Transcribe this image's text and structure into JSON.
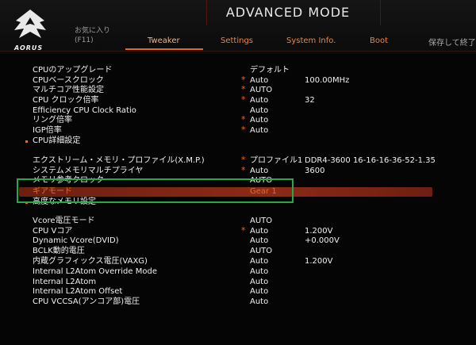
{
  "header": {
    "logo_text": "AORUS",
    "mode_title": "ADVANCED MODE",
    "back_label_line1": "お気に入り",
    "back_label_line2": "(F11)",
    "tabs": [
      "Tweaker",
      "Settings",
      "System Info.",
      "Boot"
    ],
    "active_tab": "Tweaker",
    "save_exit_label": "保存して終了"
  },
  "rows": [
    {
      "label": "CPUのアップグレード",
      "value": "デフォルト",
      "star": "",
      "extra": ""
    },
    {
      "label": "CPUベースクロック",
      "value": "Auto",
      "star": "*",
      "extra": "100.00MHz"
    },
    {
      "label": "マルチコア性能設定",
      "value": "AUTO",
      "star": "*",
      "extra": ""
    },
    {
      "label": "CPU クロック倍率",
      "value": "Auto",
      "star": "*",
      "extra": "32"
    },
    {
      "label": "Efficiency CPU Clock Ratio",
      "value": "Auto",
      "star": "",
      "extra": ""
    },
    {
      "label": "リング倍率",
      "value": "Auto",
      "star": "*",
      "extra": ""
    },
    {
      "label": "IGP倍率",
      "value": "Auto",
      "star": "*",
      "extra": ""
    },
    {
      "label": "CPU詳細設定",
      "value": "",
      "star": "",
      "extra": "",
      "bullet": true
    },
    {
      "label": "エクストリーム・メモリ・プロファイル(X.M.P.)",
      "value": "プロファイル1",
      "star": "*",
      "extra": "DDR4-3600 16-16-16-36-52-1.35"
    },
    {
      "label": "システムメモリマルチプライヤ",
      "value": "Auto",
      "star": "*",
      "extra": "3600"
    },
    {
      "label": "メモリ参考クロック",
      "value": "AUTO",
      "star": "",
      "extra": ""
    },
    {
      "label": "ギアモード",
      "value": "Gear 1",
      "star": "",
      "extra": "",
      "highlight": true
    },
    {
      "label": "高度なメモリ設定",
      "value": "",
      "star": "",
      "extra": "",
      "bullet": true
    },
    {
      "label": "Vcore電圧モード",
      "value": "AUTO",
      "star": "",
      "extra": ""
    },
    {
      "label": "CPU Vコア",
      "value": "Auto",
      "star": "*",
      "extra": "1.200V"
    },
    {
      "label": "Dynamic Vcore(DVID)",
      "value": "Auto",
      "star": "",
      "extra": "+0.000V"
    },
    {
      "label": "BCLK動的電圧",
      "value": "AUTO",
      "star": "",
      "extra": ""
    },
    {
      "label": "内蔵グラフィックス電圧(VAXG)",
      "value": "Auto",
      "star": "",
      "extra": "1.200V"
    },
    {
      "label": "Internal L2Atom Override Mode",
      "value": "Auto",
      "star": "",
      "extra": ""
    },
    {
      "label": "Internal L2Atom",
      "value": "Auto",
      "star": "",
      "extra": ""
    },
    {
      "label": "Internal L2Atom Offset",
      "value": "Auto",
      "star": "",
      "extra": ""
    },
    {
      "label": "CPU VCCSA(アンコア部)電圧",
      "value": "Auto",
      "star": "",
      "extra": ""
    }
  ]
}
